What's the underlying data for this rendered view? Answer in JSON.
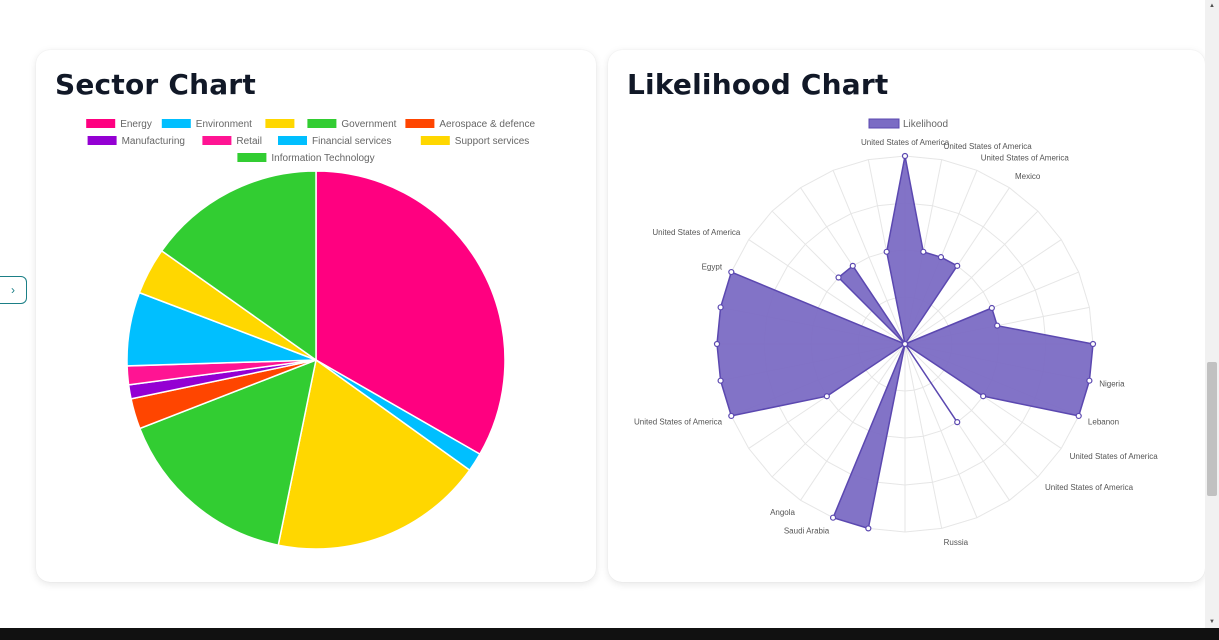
{
  "cards": {
    "sector": {
      "title": "Sector Chart"
    },
    "likelihood": {
      "title": "Likelihood Chart"
    }
  },
  "side_toggle": {
    "icon": "chevron-right-icon",
    "glyph": "›"
  },
  "chart_data": [
    {
      "type": "pie",
      "title": "Sector Chart",
      "legend_position": "top",
      "labels": [
        "Energy",
        "Environment",
        "",
        "Government",
        "Aerospace & defence",
        "Manufacturing",
        "Retail",
        "Financial services",
        "Support services",
        "Information Technology"
      ],
      "legend_colors": [
        "#ff0080",
        "#00bfff",
        "#ffd700",
        "#32cd32",
        "#ff4500",
        "#9400d3",
        "#ff1493",
        "#00bfff",
        "#ffd700",
        "#32cd32"
      ],
      "slices": [
        {
          "label": "Energy",
          "value": 33.3,
          "color": "#ff0080"
        },
        {
          "label": "Environment",
          "value": 1.6,
          "color": "#00bfff"
        },
        {
          "label": "",
          "value": 18.3,
          "color": "#ffd700"
        },
        {
          "label": "Government",
          "value": 15.9,
          "color": "#32cd32"
        },
        {
          "label": "Aerospace & defence",
          "value": 2.6,
          "color": "#ff4500"
        },
        {
          "label": "Manufacturing",
          "value": 1.2,
          "color": "#9400d3"
        },
        {
          "label": "Retail",
          "value": 1.6,
          "color": "#ff1493"
        },
        {
          "label": "Financial services",
          "value": 6.3,
          "color": "#00bfff"
        },
        {
          "label": "Support services",
          "value": 4.0,
          "color": "#ffd700"
        },
        {
          "label": "Information Technology",
          "value": 15.2,
          "color": "#32cd32"
        }
      ]
    },
    {
      "type": "radar",
      "title": "Likelihood Chart",
      "legend_position": "top",
      "series": [
        {
          "name": "Likelihood",
          "fill": "#7b6cc4",
          "stroke": "#5b48b0"
        }
      ],
      "scale": {
        "min": 0,
        "max": 4,
        "tick_label_shown": "4"
      },
      "axis_labels_shown": [
        {
          "slot": 0,
          "text": "United States of America"
        },
        {
          "slot": 1,
          "text": "United States of America"
        },
        {
          "slot": 2,
          "text": "United States of America"
        },
        {
          "slot": 3,
          "text": "Mexico"
        },
        {
          "slot": 9,
          "text": "Nigeria"
        },
        {
          "slot": 10,
          "text": "Lebanon"
        },
        {
          "slot": 11,
          "text": "United States of America"
        },
        {
          "slot": 12,
          "text": "United States of America"
        },
        {
          "slot": 15,
          "text": "Russia"
        },
        {
          "slot": 18,
          "text": "Saudi Arabia"
        },
        {
          "slot": 19,
          "text": "Angola"
        },
        {
          "slot": 22,
          "text": "United States of America"
        },
        {
          "slot": 26,
          "text": "Egypt"
        },
        {
          "slot": 27,
          "text": "United States of America"
        }
      ],
      "values": [
        4,
        2,
        2,
        2,
        0,
        0,
        2,
        2,
        4,
        4,
        4,
        2,
        0,
        2,
        0,
        0,
        0,
        4,
        4,
        0,
        0,
        2,
        4,
        4,
        4,
        4,
        4,
        0,
        2,
        2,
        0,
        2
      ]
    }
  ]
}
